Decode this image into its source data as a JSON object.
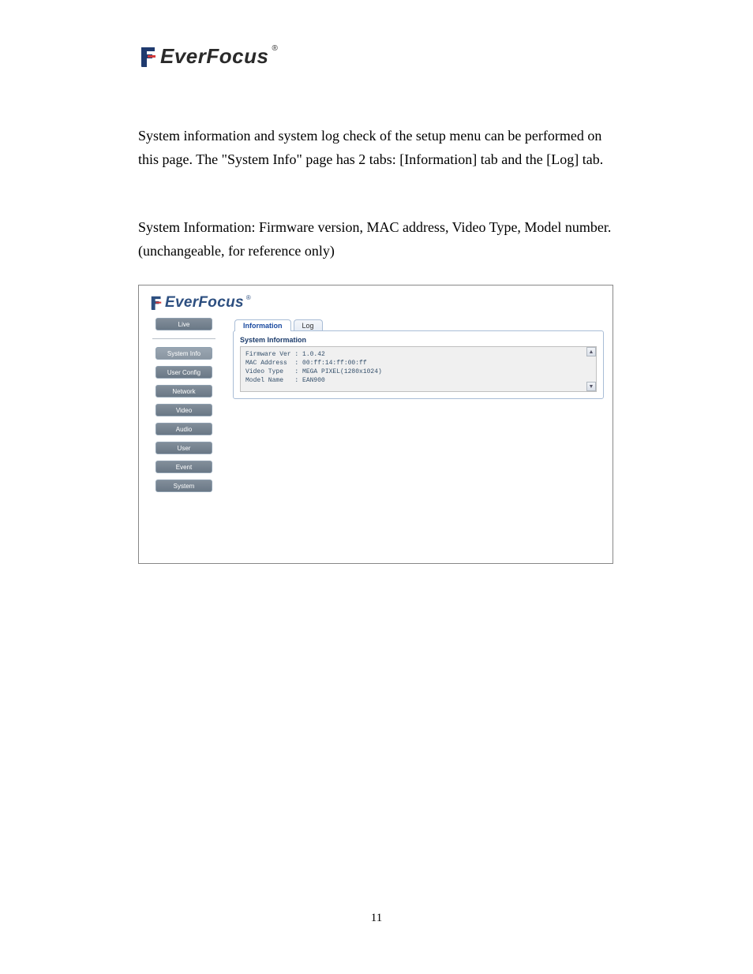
{
  "logo": {
    "brand": "EverFocus",
    "reg": "®"
  },
  "paragraph1": "System information and system log check of the setup menu can be performed on this page. The \"System Info\" page has 2 tabs: [Information] tab and the [Log] tab.",
  "paragraph2": "System Information: Firmware version, MAC address, Video Type, Model number. (unchangeable, for reference only)",
  "ui": {
    "brand": "EverFocus",
    "reg": "®",
    "sidebar": {
      "live": "Live",
      "items": [
        {
          "label": "System Info",
          "selected": true
        },
        {
          "label": "User Config",
          "selected": false
        },
        {
          "label": "Network",
          "selected": false
        },
        {
          "label": "Video",
          "selected": false
        },
        {
          "label": "Audio",
          "selected": false
        },
        {
          "label": "User",
          "selected": false
        },
        {
          "label": "Event",
          "selected": false
        },
        {
          "label": "System",
          "selected": false
        }
      ]
    },
    "tabs": {
      "information": "Information",
      "log": "Log"
    },
    "panel_title": "System Information",
    "info_text": "Firmware Ver : 1.0.42\nMAC Address  : 00:ff:14:ff:00:ff\nVideo Type   : MEGA PIXEL(1280x1024)\nModel Name   : EAN900"
  },
  "page_number": "11"
}
